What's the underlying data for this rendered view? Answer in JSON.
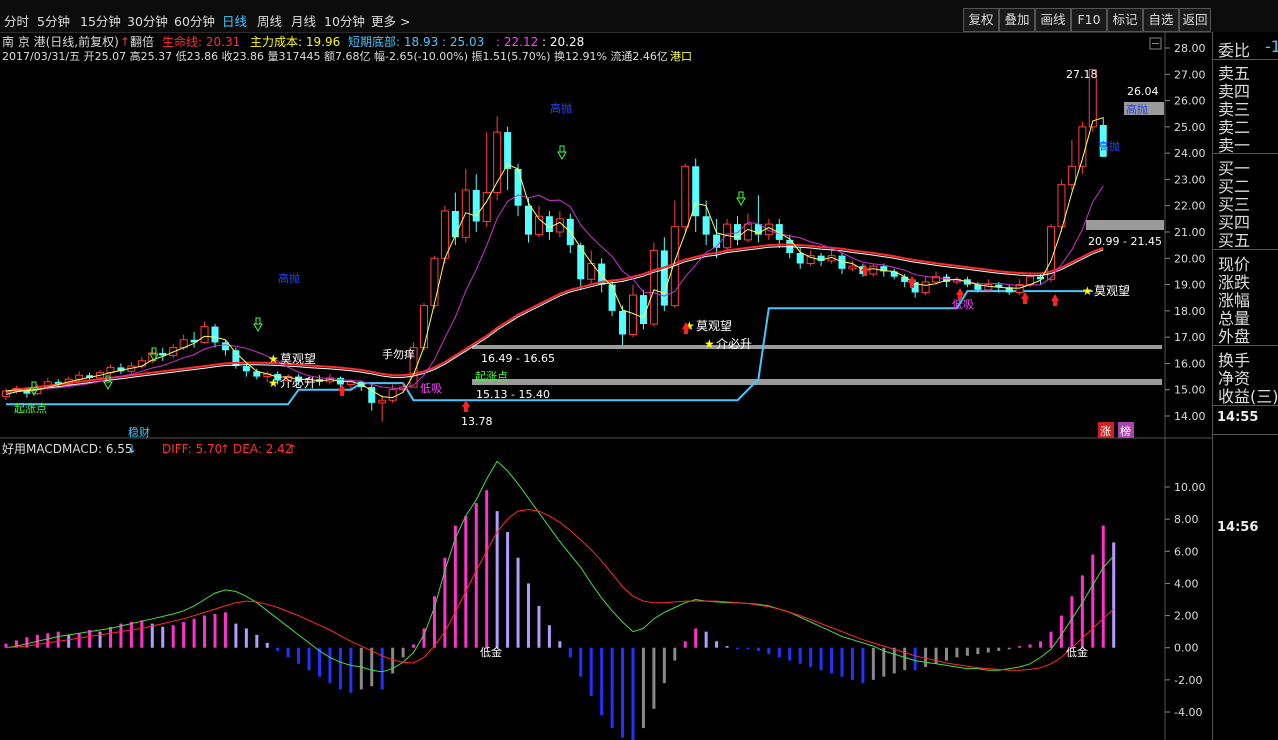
{
  "toolbar": {
    "timeframes": [
      "分时",
      "5分钟",
      "15分钟",
      "30分钟",
      "60分钟",
      "日线",
      "周线",
      "月线",
      "10分钟",
      "更多 >"
    ],
    "active_timeframe": "日线",
    "buttons": [
      "复权",
      "叠加",
      "画线",
      "F10",
      "标记",
      "自选",
      "返回"
    ]
  },
  "price_panel": {
    "header_title": "南 京 港(日线,前复权)",
    "header_marker": "翻倍",
    "header_items": [
      {
        "label": "生命线: 20.31",
        "color": "#ff3030"
      },
      {
        "label": "主力成本: 19.96",
        "color": "#ffff00"
      },
      {
        "label": "短期底部: 18.93 : 25.03",
        "color": "#44c8ff"
      },
      {
        "label": ": 22.12",
        "color": "#ff44ff"
      },
      {
        "label": ": 20.28",
        "color": "#ffffff"
      }
    ],
    "info_line": "2017/03/31/五 开25.07 高25.37 低23.86 收23.86 量317445 额7.68亿 幅-2.65(-10.00%) 振1.51(5.70%) 换12.91% 流通2.46亿",
    "info_tag": "港口",
    "y_ticks": [
      "28.00",
      "27.00",
      "26.00",
      "25.00",
      "24.00",
      "23.00",
      "22.00",
      "21.00",
      "20.00",
      "19.00",
      "18.00",
      "17.00",
      "16.00",
      "15.00",
      "14.00"
    ],
    "annotations": {
      "high_price": "27.18",
      "last_price": "26.04",
      "low_price": "13.78",
      "zone_a": "16.49 - 16.65",
      "zone_b": "15.13 - 15.40",
      "zone_c": "20.99 - 21.45"
    },
    "signals": {
      "sell_high": "高抛",
      "buy_low": "低吸",
      "wait": "莫观望",
      "focus": "介必升",
      "hold": "手勿痒",
      "stable": "稳财",
      "buy_point": "起涨点"
    },
    "tags": {
      "rise": "涨",
      "rank": "榜"
    }
  },
  "macd_panel": {
    "title": "好用MACD",
    "macd_label": "MACD: 6.55",
    "diff_label": "DIFF: 5.70",
    "dea_label": "DEA: 2.42",
    "y_ticks": [
      "10.00",
      "8.00",
      "6.00",
      "4.00",
      "2.00",
      "0.00",
      "-2.00",
      "-4.00"
    ],
    "gold_label": "低金"
  },
  "right_panel": {
    "items": [
      "委比",
      "卖五",
      "卖四",
      "卖三",
      "卖二",
      "卖一",
      "买一",
      "买二",
      "买三",
      "买四",
      "买五",
      "现价",
      "涨跌",
      "涨幅",
      "总量",
      "外盘",
      "换手",
      "净资",
      "收益(三)"
    ],
    "weibi_value": "-1",
    "time_1": "14:55",
    "time_2": "14:56"
  },
  "chart_data": {
    "type": "candlestick",
    "price_axis": [
      14.0,
      28.0
    ],
    "macd_axis": [
      -4.0,
      10.0
    ],
    "candles": [
      [
        14.75,
        14.95,
        14.6,
        15.05
      ],
      [
        14.95,
        15.05,
        14.85,
        15.15
      ],
      [
        15.05,
        14.85,
        14.7,
        15.1
      ],
      [
        14.85,
        15.1,
        14.8,
        15.2
      ],
      [
        15.1,
        15.3,
        15.0,
        15.45
      ],
      [
        15.3,
        15.2,
        15.05,
        15.4
      ],
      [
        15.2,
        15.4,
        15.1,
        15.5
      ],
      [
        15.4,
        15.55,
        15.3,
        15.7
      ],
      [
        15.55,
        15.45,
        15.3,
        15.65
      ],
      [
        15.45,
        15.65,
        15.35,
        15.75
      ],
      [
        15.65,
        15.85,
        15.55,
        15.95
      ],
      [
        15.85,
        15.7,
        15.6,
        16.0
      ],
      [
        15.7,
        15.9,
        15.6,
        16.05
      ],
      [
        15.9,
        16.1,
        15.8,
        16.25
      ],
      [
        16.1,
        16.4,
        16.0,
        16.55
      ],
      [
        16.4,
        16.3,
        16.1,
        16.6
      ],
      [
        16.3,
        16.6,
        16.2,
        16.75
      ],
      [
        16.6,
        16.9,
        16.5,
        17.1
      ],
      [
        16.9,
        16.8,
        16.6,
        17.2
      ],
      [
        16.8,
        17.4,
        16.75,
        17.6
      ],
      [
        17.4,
        16.8,
        16.6,
        17.5
      ],
      [
        16.8,
        16.5,
        16.3,
        16.9
      ],
      [
        16.5,
        15.9,
        15.8,
        16.6
      ],
      [
        15.9,
        15.7,
        15.5,
        16.0
      ],
      [
        15.7,
        15.5,
        15.4,
        15.8
      ],
      [
        15.5,
        15.6,
        15.3,
        15.7
      ],
      [
        15.6,
        15.35,
        15.2,
        15.7
      ],
      [
        15.35,
        15.5,
        15.2,
        15.6
      ],
      [
        15.5,
        15.3,
        15.15,
        15.6
      ],
      [
        15.3,
        15.4,
        15.2,
        15.5
      ],
      [
        15.4,
        15.3,
        15.15,
        15.55
      ],
      [
        15.3,
        15.45,
        15.2,
        15.6
      ],
      [
        15.45,
        15.2,
        15.1,
        15.5
      ],
      [
        15.2,
        15.3,
        15.05,
        15.4
      ],
      [
        15.3,
        15.1,
        14.95,
        15.35
      ],
      [
        15.1,
        14.5,
        14.2,
        15.2
      ],
      [
        14.5,
        14.6,
        13.78,
        14.8
      ],
      [
        14.6,
        15.0,
        14.5,
        15.2
      ],
      [
        15.0,
        15.1,
        14.9,
        15.3
      ],
      [
        15.1,
        16.6,
        15.1,
        16.8
      ],
      [
        16.6,
        18.2,
        16.5,
        18.3
      ],
      [
        18.2,
        20.0,
        18.1,
        20.1
      ],
      [
        20.0,
        21.8,
        19.8,
        22.0
      ],
      [
        21.8,
        20.8,
        20.5,
        22.5
      ],
      [
        20.8,
        22.6,
        20.6,
        23.4
      ],
      [
        22.6,
        21.4,
        21.0,
        23.2
      ],
      [
        21.4,
        22.5,
        21.2,
        24.8
      ],
      [
        22.5,
        24.8,
        22.2,
        25.4
      ],
      [
        24.8,
        23.4,
        22.6,
        25.0
      ],
      [
        23.4,
        22.0,
        21.6,
        23.6
      ],
      [
        22.0,
        20.9,
        20.6,
        22.3
      ],
      [
        20.9,
        21.6,
        20.8,
        22.0
      ],
      [
        21.6,
        21.0,
        20.7,
        21.8
      ],
      [
        21.0,
        21.5,
        20.8,
        21.8
      ],
      [
        21.5,
        20.5,
        20.2,
        21.7
      ],
      [
        20.5,
        19.2,
        18.8,
        20.6
      ],
      [
        19.2,
        19.8,
        19.0,
        20.3
      ],
      [
        19.8,
        19.0,
        18.7,
        20.0
      ],
      [
        19.0,
        18.0,
        17.8,
        19.2
      ],
      [
        18.0,
        17.1,
        16.7,
        18.2
      ],
      [
        17.1,
        18.6,
        17.0,
        19.0
      ],
      [
        18.6,
        17.5,
        17.3,
        18.8
      ],
      [
        17.5,
        20.3,
        17.4,
        20.6
      ],
      [
        20.3,
        18.2,
        18.0,
        20.8
      ],
      [
        18.2,
        21.2,
        18.1,
        22.2
      ],
      [
        21.2,
        23.5,
        21.0,
        23.6
      ],
      [
        23.5,
        21.6,
        21.0,
        23.8
      ],
      [
        21.6,
        20.9,
        20.5,
        22.2
      ],
      [
        20.9,
        20.4,
        20.0,
        21.5
      ],
      [
        20.4,
        21.3,
        20.2,
        21.5
      ],
      [
        21.3,
        20.7,
        20.5,
        21.6
      ],
      [
        20.7,
        21.3,
        20.6,
        21.7
      ],
      [
        21.3,
        20.9,
        20.6,
        22.4
      ],
      [
        20.9,
        21.3,
        20.7,
        21.5
      ],
      [
        21.3,
        20.7,
        20.4,
        21.5
      ],
      [
        20.7,
        20.2,
        20.0,
        20.9
      ],
      [
        20.2,
        19.8,
        19.6,
        20.4
      ],
      [
        19.8,
        20.1,
        19.7,
        20.3
      ],
      [
        20.1,
        19.9,
        19.7,
        20.2
      ],
      [
        19.9,
        20.1,
        19.8,
        20.3
      ],
      [
        20.1,
        19.6,
        19.4,
        20.2
      ],
      [
        19.6,
        19.7,
        19.5,
        19.9
      ],
      [
        19.7,
        19.4,
        19.3,
        19.8
      ],
      [
        19.4,
        19.7,
        19.3,
        19.8
      ],
      [
        19.7,
        19.5,
        19.3,
        19.8
      ],
      [
        19.5,
        19.3,
        19.2,
        19.6
      ],
      [
        19.3,
        19.1,
        18.9,
        19.4
      ],
      [
        19.1,
        18.7,
        18.5,
        19.2
      ],
      [
        18.7,
        19.1,
        18.6,
        19.3
      ],
      [
        19.1,
        19.3,
        19.0,
        19.5
      ],
      [
        19.3,
        19.1,
        18.9,
        19.4
      ],
      [
        19.1,
        19.2,
        19.0,
        19.3
      ],
      [
        19.2,
        19.0,
        18.9,
        19.3
      ],
      [
        19.0,
        18.8,
        18.7,
        19.1
      ],
      [
        18.8,
        19.0,
        18.7,
        19.2
      ],
      [
        19.0,
        18.9,
        18.7,
        19.1
      ],
      [
        18.9,
        18.7,
        18.6,
        19.0
      ],
      [
        18.7,
        19.0,
        18.6,
        19.2
      ],
      [
        19.0,
        19.3,
        18.9,
        19.4
      ],
      [
        19.3,
        19.2,
        19.0,
        19.4
      ],
      [
        19.2,
        21.2,
        19.1,
        21.3
      ],
      [
        21.2,
        22.8,
        21.0,
        23.0
      ],
      [
        22.8,
        23.5,
        22.6,
        24.5
      ],
      [
        23.5,
        25.0,
        23.2,
        25.2
      ],
      [
        25.0,
        27.18,
        24.8,
        27.18
      ],
      [
        25.07,
        23.86,
        23.86,
        25.37
      ]
    ],
    "lifeline": [
      14.9,
      15.0,
      15.05,
      15.1,
      15.15,
      15.2,
      15.25,
      15.3,
      15.35,
      15.4,
      15.45,
      15.5,
      15.55,
      15.6,
      15.65,
      15.7,
      15.75,
      15.8,
      15.85,
      15.9,
      15.95,
      16.0,
      16.02,
      16.03,
      16.03,
      16.02,
      16.0,
      15.98,
      15.95,
      15.92,
      15.9,
      15.87,
      15.84,
      15.8,
      15.75,
      15.68,
      15.6,
      15.55,
      15.55,
      15.6,
      15.7,
      15.85,
      16.05,
      16.3,
      16.55,
      16.8,
      17.05,
      17.35,
      17.6,
      17.85,
      18.05,
      18.25,
      18.45,
      18.65,
      18.8,
      18.9,
      19.0,
      19.1,
      19.15,
      19.2,
      19.3,
      19.4,
      19.55,
      19.65,
      19.8,
      19.95,
      20.05,
      20.15,
      20.2,
      20.3,
      20.35,
      20.4,
      20.45,
      20.5,
      20.52,
      20.52,
      20.5,
      20.47,
      20.43,
      20.4,
      20.36,
      20.3,
      20.25,
      20.2,
      20.14,
      20.08,
      20.0,
      19.93,
      19.87,
      19.81,
      19.76,
      19.71,
      19.66,
      19.61,
      19.56,
      19.51,
      19.47,
      19.44,
      19.42,
      19.42,
      19.5,
      19.65,
      19.85,
      20.05,
      20.25,
      20.4
    ],
    "macd": {
      "hist": [
        0.25,
        0.45,
        0.65,
        0.8,
        0.9,
        1.0,
        0.8,
        0.9,
        1.1,
        1.0,
        1.3,
        1.5,
        1.6,
        1.7,
        1.5,
        1.3,
        1.4,
        1.6,
        1.8,
        2.0,
        2.1,
        2.2,
        1.5,
        1.2,
        0.8,
        0.3,
        -0.2,
        -0.6,
        -1.0,
        -1.4,
        -1.8,
        -2.2,
        -2.6,
        -2.8,
        -2.6,
        -2.4,
        -2.6,
        -1.6,
        -0.6,
        0.2,
        1.2,
        3.2,
        5.6,
        7.6,
        8.2,
        9.0,
        9.8,
        8.5,
        7.2,
        5.6,
        4.0,
        2.6,
        1.4,
        0.4,
        -0.6,
        -1.8,
        -3.0,
        -4.2,
        -5.0,
        -5.6,
        -5.8,
        -5.0,
        -3.8,
        -2.2,
        -0.8,
        0.4,
        1.2,
        1.0,
        0.4,
        0.1,
        -0.1,
        -0.1,
        -0.2,
        -0.4,
        -0.6,
        -0.8,
        -1.0,
        -1.2,
        -1.4,
        -1.6,
        -1.8,
        -2.0,
        -2.2,
        -2.0,
        -1.8,
        -1.6,
        -1.4,
        -1.4,
        -1.2,
        -1.0,
        -0.8,
        -0.6,
        -0.5,
        -0.4,
        -0.3,
        -0.2,
        -0.1,
        0.1,
        0.2,
        0.4,
        1.0,
        2.0,
        3.2,
        4.5,
        5.8,
        7.6,
        6.55
      ],
      "diff": [
        0.0,
        0.1,
        0.25,
        0.4,
        0.55,
        0.7,
        0.8,
        0.9,
        1.0,
        1.1,
        1.2,
        1.35,
        1.5,
        1.65,
        1.8,
        1.95,
        2.1,
        2.3,
        2.6,
        3.0,
        3.4,
        3.6,
        3.5,
        3.2,
        2.8,
        2.3,
        1.8,
        1.3,
        0.8,
        0.3,
        -0.2,
        -0.6,
        -0.9,
        -1.1,
        -1.2,
        -1.4,
        -1.5,
        -1.3,
        -0.9,
        -0.3,
        0.8,
        2.5,
        4.8,
        6.8,
        8.2,
        9.2,
        10.5,
        11.6,
        11.0,
        10.2,
        9.3,
        8.4,
        7.5,
        6.6,
        5.8,
        5.0,
        4.0,
        3.1,
        2.3,
        1.6,
        1.0,
        1.2,
        1.8,
        2.2,
        2.5,
        2.8,
        3.0,
        2.9,
        2.85,
        2.8,
        2.8,
        2.75,
        2.7,
        2.6,
        2.4,
        2.2,
        1.9,
        1.6,
        1.3,
        1.0,
        0.7,
        0.5,
        0.3,
        0.1,
        -0.2,
        -0.4,
        -0.6,
        -0.8,
        -0.9,
        -1.0,
        -1.1,
        -1.2,
        -1.3,
        -1.3,
        -1.4,
        -1.4,
        -1.3,
        -1.2,
        -1.0,
        -0.6,
        -0.1,
        0.8,
        1.8,
        2.8,
        3.9,
        5.0,
        5.7
      ],
      "dea": [
        0.0,
        0.05,
        0.1,
        0.2,
        0.3,
        0.4,
        0.5,
        0.6,
        0.7,
        0.8,
        0.9,
        1.0,
        1.1,
        1.2,
        1.35,
        1.5,
        1.65,
        1.8,
        2.0,
        2.2,
        2.4,
        2.6,
        2.8,
        2.9,
        2.85,
        2.7,
        2.5,
        2.25,
        2.0,
        1.7,
        1.4,
        1.1,
        0.75,
        0.4,
        0.1,
        -0.2,
        -0.5,
        -0.75,
        -0.9,
        -0.95,
        -0.6,
        0.1,
        1.0,
        2.2,
        3.5,
        4.8,
        6.0,
        7.2,
        8.0,
        8.5,
        8.6,
        8.5,
        8.2,
        7.8,
        7.3,
        6.7,
        6.1,
        5.4,
        4.6,
        3.8,
        3.2,
        2.9,
        2.8,
        2.8,
        2.85,
        2.9,
        2.9,
        2.9,
        2.9,
        2.85,
        2.8,
        2.75,
        2.65,
        2.55,
        2.4,
        2.2,
        2.0,
        1.75,
        1.5,
        1.25,
        1.0,
        0.75,
        0.5,
        0.3,
        0.1,
        -0.1,
        -0.3,
        -0.5,
        -0.65,
        -0.8,
        -0.95,
        -1.05,
        -1.15,
        -1.25,
        -1.3,
        -1.35,
        -1.4,
        -1.4,
        -1.35,
        -1.25,
        -1.0,
        -0.6,
        0.0,
        0.6,
        1.2,
        1.8,
        2.42
      ]
    }
  }
}
